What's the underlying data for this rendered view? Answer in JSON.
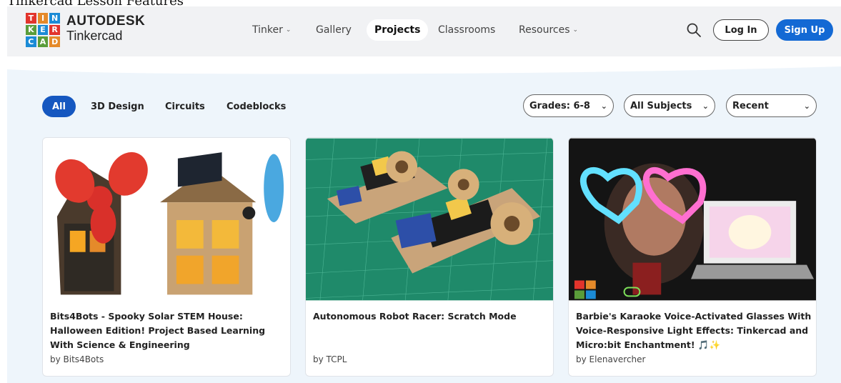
{
  "caption": "Tinkercad Lesson Features",
  "brand": {
    "letters": [
      "T",
      "I",
      "N",
      "K",
      "E",
      "R",
      "C",
      "A",
      "D"
    ],
    "name_line1": "AUTODESK",
    "name_line2": "Tinkercad"
  },
  "nav": {
    "items": [
      {
        "label": "Tinker",
        "dropdown": true
      },
      {
        "label": "Gallery",
        "dropdown": false
      },
      {
        "label": "Projects",
        "dropdown": false,
        "active": true
      },
      {
        "label": "Classrooms",
        "dropdown": false
      },
      {
        "label": "Resources",
        "dropdown": true
      }
    ],
    "login_label": "Log In",
    "signup_label": "Sign Up"
  },
  "filters": [
    "All",
    "3D Design",
    "Circuits",
    "Codeblocks"
  ],
  "selects": {
    "grades": "Grades: 6-8",
    "subjects": "All Subjects",
    "sort": "Recent"
  },
  "cards": [
    {
      "title": "Bits4Bots - Spooky Solar STEM House: Halloween Edition! Project Based Learning With Science & Engineering",
      "author": "by Bits4Bots"
    },
    {
      "title": "Autonomous Robot Racer: Scratch Mode",
      "author": "by TCPL"
    },
    {
      "title": "Barbie's Karaoke Voice-Activated Glasses With Voice-Responsive Light Effects: Tinkercad and Micro:bit Enchantment! 🎵✨",
      "author": "by Elenavercher"
    }
  ],
  "colors": {
    "accent": "#1369d4",
    "filter_active": "#1557c0",
    "logo": [
      "#e2342c",
      "#e58a2a",
      "#1b8bd6",
      "#5a9d3a",
      "#1b8bd6",
      "#e2342c",
      "#1b8bd6",
      "#5a9d3a",
      "#e58a2a"
    ]
  }
}
